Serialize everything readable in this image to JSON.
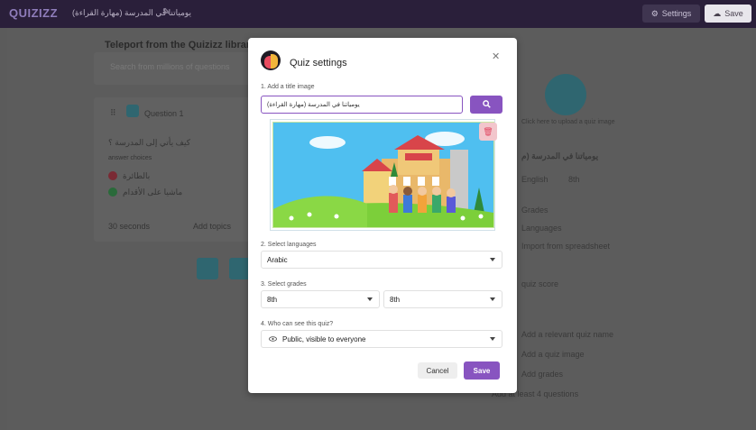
{
  "topbar": {
    "logo": "QUIZIZZ",
    "quiz_title": "يومياتنا في المدرسة (مهارة القراءة)",
    "settings_label": "Settings",
    "save_label": "Save"
  },
  "background": {
    "teleport_title": "Teleport from the Quizizz library",
    "search_placeholder": "Search from millions of questions",
    "question_label": "Question 1",
    "question_text": "كيف يأتي إلى المدرسة ؟",
    "answer_choices_label": "answer choices",
    "answer_1": "بالطائرة",
    "answer_2": "ماشيا على الأقدام",
    "time_label": "30 seconds",
    "topics_label": "Add topics",
    "upload_hint": "Click here to upload a quiz image",
    "right_title": "يومياتنا في المدرسة (م",
    "right_lang": "English",
    "right_grade": "8th",
    "right_items": [
      "Grades",
      "Languages",
      "Import from spreadsheet",
      "quiz score",
      "Add a relevant quiz name",
      "Add a quiz image",
      "Add grades",
      "Add at least 4 questions"
    ]
  },
  "modal": {
    "title": "Quiz settings",
    "step1_label": "1. Add a title image",
    "title_input_value": "يومياتنا في المدرسة (مهارة القراءة)",
    "step2_label": "2. Select languages",
    "language_value": "Arabic",
    "step3_label": "3. Select grades",
    "grade_from": "8th",
    "grade_to": "8th",
    "step4_label": "4. Who can see this quiz?",
    "visibility_value": "Public, visible to everyone",
    "cancel_label": "Cancel",
    "save_label": "Save"
  },
  "colors": {
    "accent": "#8854c0",
    "topbar": "#2a1f3a",
    "teal": "#2f6670",
    "delete": "#e04660"
  },
  "icons": {
    "pencil": "pencil-icon",
    "gear": "gear-icon",
    "cloud": "cloud-upload-icon",
    "close": "close-icon",
    "search": "search-icon",
    "trash": "trash-icon",
    "eye": "eye-icon"
  }
}
